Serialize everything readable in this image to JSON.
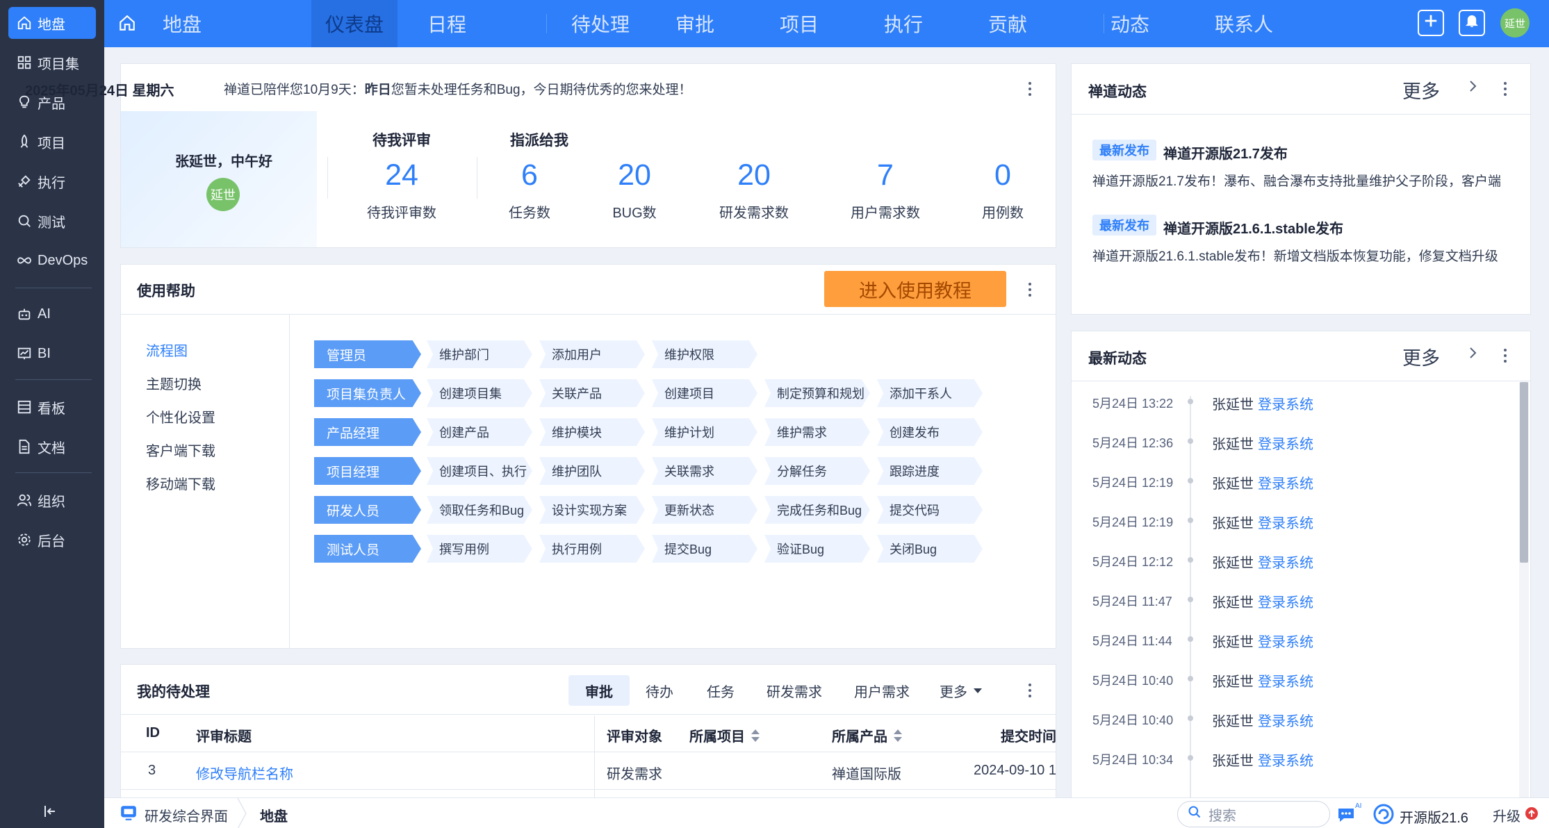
{
  "colors": {
    "primary": "#2e7ff9",
    "sidebar_bg": "#2b3447",
    "accent_orange": "#ff9e3d",
    "avatar_green": "#78c36a"
  },
  "sidebar": {
    "items": [
      {
        "label": "地盘",
        "icon": "home-icon"
      },
      {
        "label": "项目集",
        "icon": "grid-icon"
      },
      {
        "label": "产品",
        "icon": "bulb-icon"
      },
      {
        "label": "项目",
        "icon": "rocket-icon"
      },
      {
        "label": "执行",
        "icon": "run-icon"
      },
      {
        "label": "测试",
        "icon": "search-check-icon"
      },
      {
        "label": "DevOps",
        "icon": "infinity-icon"
      },
      {
        "label": "AI",
        "icon": "robot-icon"
      },
      {
        "label": "BI",
        "icon": "chart-icon"
      },
      {
        "label": "看板",
        "icon": "kanban-icon"
      },
      {
        "label": "文档",
        "icon": "document-icon"
      },
      {
        "label": "组织",
        "icon": "people-icon"
      },
      {
        "label": "后台",
        "icon": "gear-icon"
      }
    ]
  },
  "topbar": {
    "title": "地盘",
    "tabs": [
      "仪表盘",
      "日程",
      "待处理",
      "审批",
      "项目",
      "执行",
      "贡献",
      "动态",
      "联系人"
    ],
    "active_tab": "仪表盘",
    "avatar_text": "延世"
  },
  "welcome": {
    "date": "2025年05月24日 星期六",
    "msg_prefix": "禅道已陪伴您10月9天：",
    "msg_bold": "昨日",
    "msg_suffix": "您暂未处理任务和Bug，今日期待优秀的您来处理！",
    "greeting": "张延世，中午好",
    "avatar_text": "延世",
    "review_title": "待我评审",
    "assign_title": "指派给我",
    "stats": [
      {
        "value": "24",
        "label": "待我评审数"
      },
      {
        "value": "6",
        "label": "任务数"
      },
      {
        "value": "20",
        "label": "BUG数"
      },
      {
        "value": "20",
        "label": "研发需求数"
      },
      {
        "value": "7",
        "label": "用户需求数"
      },
      {
        "value": "0",
        "label": "用例数"
      }
    ]
  },
  "help": {
    "title": "使用帮助",
    "tutorial_button": "进入使用教程",
    "menu": [
      "流程图",
      "主题切换",
      "个性化设置",
      "客户端下载",
      "移动端下载"
    ],
    "active_menu": "流程图",
    "flows": [
      {
        "role": "管理员",
        "steps": [
          "维护部门",
          "添加用户",
          "维护权限"
        ]
      },
      {
        "role": "项目集负责人",
        "steps": [
          "创建项目集",
          "关联产品",
          "创建项目",
          "制定预算和规划",
          "添加干系人"
        ]
      },
      {
        "role": "产品经理",
        "steps": [
          "创建产品",
          "维护模块",
          "维护计划",
          "维护需求",
          "创建发布"
        ]
      },
      {
        "role": "项目经理",
        "steps": [
          "创建项目、执行",
          "维护团队",
          "关联需求",
          "分解任务",
          "跟踪进度"
        ]
      },
      {
        "role": "研发人员",
        "steps": [
          "领取任务和Bug",
          "设计实现方案",
          "更新状态",
          "完成任务和Bug",
          "提交代码"
        ]
      },
      {
        "role": "测试人员",
        "steps": [
          "撰写用例",
          "执行用例",
          "提交Bug",
          "验证Bug",
          "关闭Bug"
        ]
      }
    ]
  },
  "todo": {
    "title": "我的待处理",
    "tabs": [
      "审批",
      "待办",
      "任务",
      "研发需求",
      "用户需求",
      "更多"
    ],
    "active_tab": "审批",
    "columns": [
      "ID",
      "评审标题",
      "评审对象",
      "所属项目",
      "所属产品",
      "提交时间"
    ],
    "rows": [
      {
        "id": "3",
        "title": "修改导航栏名称",
        "object": "研发需求",
        "project": "",
        "product": "禅道国际版",
        "time": "2024-09-10 1"
      }
    ]
  },
  "zentao_news": {
    "title": "禅道动态",
    "more": "更多",
    "items": [
      {
        "badge": "最新发布",
        "title": "禅道开源版21.7发布",
        "desc": "禅道开源版21.7发布！瀑布、融合瀑布支持批量维护父子阶段，客户端"
      },
      {
        "badge": "最新发布",
        "title": "禅道开源版21.6.1.stable发布",
        "desc": "禅道开源版21.6.1.stable发布！新增文档版本恢复功能，修复文档升级"
      }
    ]
  },
  "activity": {
    "title": "最新动态",
    "more": "更多",
    "items": [
      {
        "time": "5月24日 13:22",
        "user": "张延世",
        "action": "登录系统"
      },
      {
        "time": "5月24日 12:36",
        "user": "张延世",
        "action": "登录系统"
      },
      {
        "time": "5月24日 12:19",
        "user": "张延世",
        "action": "登录系统"
      },
      {
        "time": "5月24日 12:19",
        "user": "张延世",
        "action": "登录系统"
      },
      {
        "time": "5月24日 12:12",
        "user": "张延世",
        "action": "登录系统"
      },
      {
        "time": "5月24日 11:47",
        "user": "张延世",
        "action": "登录系统"
      },
      {
        "time": "5月24日 11:44",
        "user": "张延世",
        "action": "登录系统"
      },
      {
        "time": "5月24日 10:40",
        "user": "张延世",
        "action": "登录系统"
      },
      {
        "time": "5月24日 10:40",
        "user": "张延世",
        "action": "登录系统"
      },
      {
        "time": "5月24日 10:34",
        "user": "张延世",
        "action": "登录系统"
      }
    ]
  },
  "bottombar": {
    "app": "研发综合界面",
    "breadcrumb": "地盘",
    "search_placeholder": "搜索",
    "ai_badge": "AI",
    "version": "开源版21.6",
    "upgrade": "升级"
  }
}
